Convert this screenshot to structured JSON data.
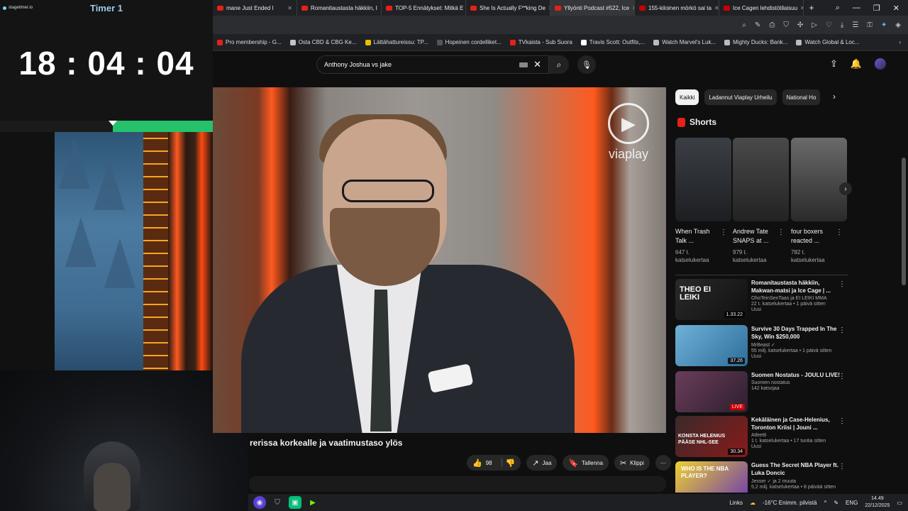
{
  "timer": {
    "brand": "stagetimer.io",
    "name": "Timer 1",
    "time": "18 : 04 : 04",
    "progress_fill": 0.47
  },
  "browser": {
    "tabs": [
      {
        "label": "mane Just Ended I",
        "active": false
      },
      {
        "label": "Romanitaustasta häkkiin, I",
        "active": false
      },
      {
        "label": "TOP-5 Ennätykset: Mitkä E",
        "active": false
      },
      {
        "label": "She Is Actually F**king De",
        "active": false
      },
      {
        "label": "Yllyönti Podcast #522, Ice",
        "active": true
      },
      {
        "label": "155-kiloinen mörkö sai ta",
        "active": false
      },
      {
        "label": "Ice Cagen lehdistötilaisuu",
        "active": false
      }
    ],
    "new_tab": "+",
    "bookmarks": [
      "Pro membership - G...",
      "Osta CBD & CBG Ke...",
      "Lättähattureissu: TP...",
      "Hopeinen cordelliket...",
      "TVkaista - Sub Suora",
      "Travis Scott: Outfits,...",
      "Watch Marvel's Luk...",
      "Mighty Ducks: Bank...",
      "Watch Global & Loc..."
    ]
  },
  "youtube": {
    "search_value": "Anthony Joshua vs jake",
    "video_logo": "viaplay",
    "video_title": "Areenalla ja Yllyönti pippurissa korkealle ja vaatimustaso ylös",
    "video_title_visible": "rerissa korkealle ja vaatimustaso ylös",
    "actions": {
      "likes": "98",
      "share": "Jaa",
      "save": "Tallenna",
      "clip": "Klippi",
      "more": "⋯"
    },
    "chips": [
      "Kaikki",
      "Ladannut Viaplay Urheilu",
      "National Ho"
    ],
    "shorts_heading": "Shorts",
    "shorts": [
      {
        "title": "When Trash Talk ...",
        "views": "647 t. katselukertaa"
      },
      {
        "title": "Andrew Tate SNAPS at ...",
        "views": "979 t. katselukertaa"
      },
      {
        "title": "four boxers reacted ...",
        "views": "782 t. katselukertaa"
      }
    ],
    "recommended": [
      {
        "title": "Romanitaustasta häkkiin, Makwan-matsi ja Ice Cage | ...",
        "channel": "OhoTeinSenTaas ja EI LEIKI MMA",
        "meta": "22 t. katselukertaa • 1 päivä sitten",
        "badge": "Uusi",
        "duration": "1.33.22",
        "thumb_text": "THEO EI LEIKI"
      },
      {
        "title": "Survive 30 Days Trapped In The Sky, Win $250,000",
        "channel": "MrBeast ✓",
        "meta": "55 milj. katselukertaa • 1 päivä sitten",
        "badge": "Uusi",
        "duration": "37.26",
        "thumb_text": ""
      },
      {
        "title": "Suomen Nostatus - JOULU LIVE!",
        "channel": "Suomen nostatus",
        "meta": "142 katsojaa",
        "badge": "",
        "duration": "LIVE",
        "thumb_text": ""
      },
      {
        "title": "Kekäläinen ja Case-Helenius, Toronton Kriisi | Jouni ...",
        "channel": "Atleetti",
        "meta": "1 t. katselukertaa • 17 tuntia sitten",
        "badge": "Uusi",
        "duration": "30.34",
        "thumb_text": "KONSTA HELENIUS PÄÄSE NHL-SEE"
      },
      {
        "title": "Guess The Secret NBA Player ft. Luka Doncic",
        "channel": "Jesser ✓ ja 2 muuta",
        "meta": "5,2 milj. katselukertaa • 8 päivää sitten",
        "badge": "",
        "duration": "",
        "thumb_text": "WHO IS THE NBA PLAYER?"
      }
    ]
  },
  "taskbar": {
    "links": "Links",
    "weather": "-16°C  Enimm. pilvistä",
    "lang": "ENG",
    "time": "14.49",
    "date": "22/12/2025"
  }
}
